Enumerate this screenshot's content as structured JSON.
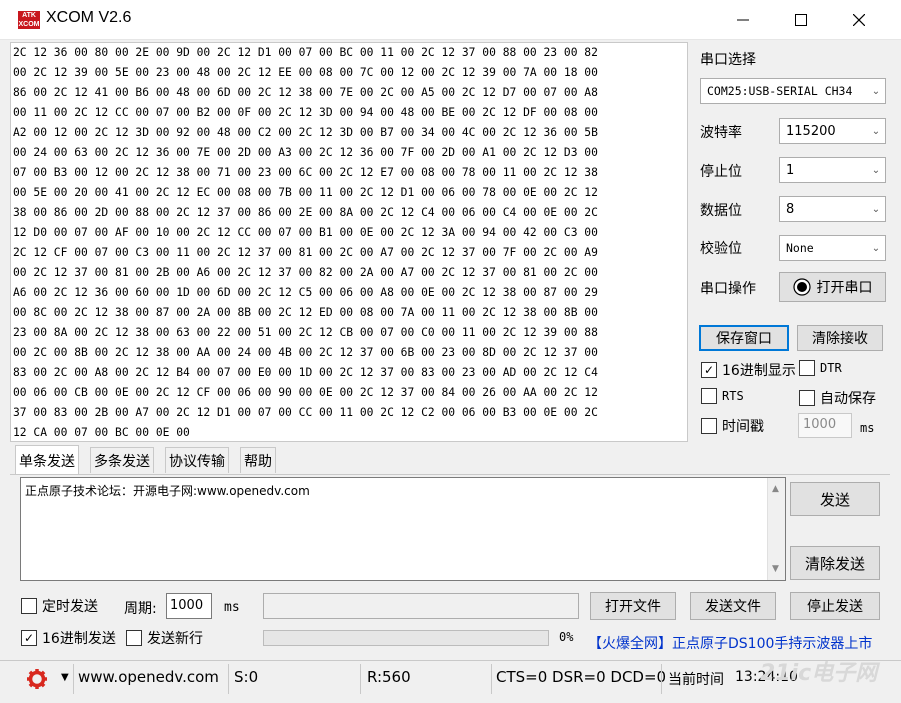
{
  "window": {
    "logo_text": "ATK XCOM",
    "title": "XCOM V2.6",
    "minimize": "—",
    "maximize": "☐",
    "close": "✕"
  },
  "receive_lines": [
    "2C 12 36 00 80 00 2E 00 9D 00 2C 12 D1 00 07 00 BC 00 11 00 2C 12 37 00 88 00 23 00 82",
    "00 2C 12 39 00 5E 00 23 00 48 00 2C 12 EE 00 08 00 7C 00 12 00 2C 12 39 00 7A 00 18 00",
    "86 00 2C 12 41 00 B6 00 48 00 6D 00 2C 12 38 00 7E 00 2C 00 A5 00 2C 12 D7 00 07 00 A8",
    "00 11 00 2C 12 CC 00 07 00 B2 00 0F 00 2C 12 3D 00 94 00 48 00 BE 00 2C 12 DF 00 08 00",
    "A2 00 12 00 2C 12 3D 00 92 00 48 00 C2 00 2C 12 3D 00 B7 00 34 00 4C 00 2C 12 36 00 5B",
    "00 24 00 63 00 2C 12 36 00 7E 00 2D 00 A3 00 2C 12 36 00 7F 00 2D 00 A1 00 2C 12 D3 00",
    "07 00 B3 00 12 00 2C 12 38 00 71 00 23 00 6C 00 2C 12 E7 00 08 00 78 00 11 00 2C 12 38",
    "00 5E 00 20 00 41 00 2C 12 EC 00 08 00 7B 00 11 00 2C 12 D1 00 06 00 78 00 0E 00 2C 12",
    "38 00 86 00 2D 00 88 00 2C 12 37 00 86 00 2E 00 8A 00 2C 12 C4 00 06 00 C4 00 0E 00 2C",
    "12 D0 00 07 00 AF 00 10 00 2C 12 CC 00 07 00 B1 00 0E 00 2C 12 3A 00 94 00 42 00 C3 00",
    "2C 12 CF 00 07 00 C3 00 11 00 2C 12 37 00 81 00 2C 00 A7 00 2C 12 37 00 7F 00 2C 00 A9",
    "00 2C 12 37 00 81 00 2B 00 A6 00 2C 12 37 00 82 00 2A 00 A7 00 2C 12 37 00 81 00 2C 00",
    "A6 00 2C 12 36 00 60 00 1D 00 6D 00 2C 12 C5 00 06 00 A8 00 0E 00 2C 12 38 00 87 00 29",
    "00 8C 00 2C 12 38 00 87 00 2A 00 8B 00 2C 12 ED 00 08 00 7A 00 11 00 2C 12 38 00 8B 00",
    "23 00 8A 00 2C 12 38 00 63 00 22 00 51 00 2C 12 CB 00 07 00 C0 00 11 00 2C 12 39 00 88",
    "00 2C 00 8B 00 2C 12 38 00 AA 00 24 00 4B 00 2C 12 37 00 6B 00 23 00 8D 00 2C 12 37 00",
    "83 00 2C 00 A8 00 2C 12 B4 00 07 00 E0 00 1D 00 2C 12 37 00 83 00 23 00 AD 00 2C 12 C4",
    "00 06 00 CB 00 0E 00 2C 12 CF 00 06 00 90 00 0E 00 2C 12 37 00 84 00 26 00 AA 00 2C 12",
    "37 00 83 00 2B 00 A7 00 2C 12 D1 00 07 00 CC 00 11 00 2C 12 C2 00 06 00 B3 00 0E 00 2C",
    "12 CA 00 07 00 BC 00 0E 00"
  ],
  "settings": {
    "port_label": "串口选择",
    "port_value": "COM25:USB-SERIAL CH34",
    "baud_label": "波特率",
    "baud_value": "115200",
    "stop_label": "停止位",
    "stop_value": "1",
    "data_label": "数据位",
    "data_value": "8",
    "parity_label": "校验位",
    "parity_value": "None",
    "op_label": "串口操作",
    "open_port": "打开串口"
  },
  "buttons": {
    "save_window": "保存窗口",
    "clear_receive": "清除接收",
    "send": "发送",
    "clear_send": "清除发送",
    "open_file": "打开文件",
    "send_file": "发送文件",
    "stop_send": "停止发送"
  },
  "options": {
    "hex_display": "16进制显示",
    "dtr": "DTR",
    "rts": "RTS",
    "auto_save": "自动保存",
    "timestamp": "时间戳",
    "timestamp_value": "1000",
    "ms": "ms",
    "timed_send": "定时发送",
    "period_label": "周期:",
    "period_value": "1000",
    "period_ms": "ms",
    "hex_send": "16进制发送",
    "send_newline": "发送新行",
    "progress": "0%"
  },
  "tabs": [
    "单条发送",
    "多条发送",
    "协议传输",
    "帮助"
  ],
  "send_text": "正点原子技术论坛：开源电子网:www.openedv.com",
  "ad_text": "【火爆全网】正点原子DS100手持示波器上市",
  "status": {
    "website": "www.openedv.com",
    "sent": "S:0",
    "received": "R:560",
    "lines": "CTS=0 DSR=0 DCD=0",
    "time_label": "当前时间",
    "time": "13:24:10",
    "watermark": "21ic电子网"
  },
  "colors": {
    "accent": "#0078d7",
    "ad": "#0033cc",
    "gear": "#d8281e"
  }
}
